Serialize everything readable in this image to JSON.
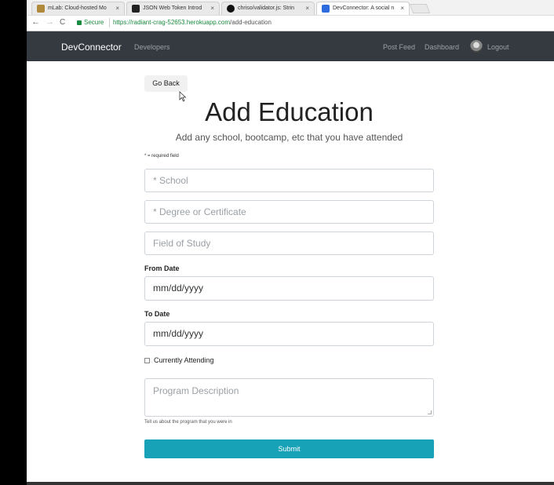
{
  "browser": {
    "tabs": [
      {
        "label": "mLab: Cloud-hosted Mo",
        "color": "#b08a3a"
      },
      {
        "label": "JSON Web Token Introd",
        "color": "#222222"
      },
      {
        "label": "chriso/validator.js: Strin",
        "color": "#111111"
      },
      {
        "label": "DevConnector: A social n",
        "color": "#2d6cdf"
      }
    ],
    "back_glyph": "←",
    "forward_glyph": "→",
    "reload_glyph": "C",
    "secure_label": "Secure",
    "url_host": "https://radiant-crag-52653.herokuapp.com",
    "url_path": "/add-education",
    "tab_close": "×"
  },
  "navbar": {
    "brand": "DevConnector",
    "developers": "Developers",
    "post_feed": "Post Feed",
    "dashboard": "Dashboard",
    "logout": "Logout"
  },
  "page": {
    "go_back": "Go Back",
    "title": "Add Education",
    "lead": "Add any school, bootcamp, etc that you have attended",
    "required_note": "* = required field",
    "school_placeholder": "* School",
    "degree_placeholder": "* Degree or Certificate",
    "field_placeholder": "Field of Study",
    "from_label": "From Date",
    "from_value": "mm/dd/yyyy",
    "to_label": "To Date",
    "to_value": "mm/dd/yyyy",
    "current_label": "Currently Attending",
    "description_placeholder": "Program Description",
    "description_help": "Tell us about the program that you were in",
    "submit": "Submit"
  },
  "colors": {
    "navbar_bg": "#343a40",
    "submit_bg": "#17a2b8",
    "secure": "#1a8a3e"
  }
}
